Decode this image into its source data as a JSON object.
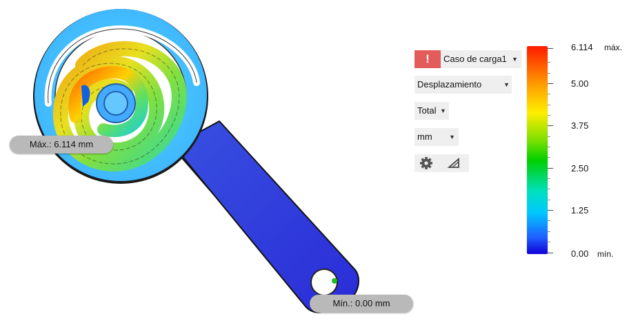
{
  "probes": {
    "max_label": "Máx.: 6.114 mm",
    "min_label": "Mín.: 0.00 mm"
  },
  "panel": {
    "warning_glyph": "!",
    "load_case": "Caso de carga1",
    "result_type": "Desplazamiento",
    "component": "Total",
    "units": "mm",
    "tools": {
      "settings_icon": "gear-icon",
      "deformation_icon": "triangle-scale-icon"
    }
  },
  "legend": {
    "max_value": "6.114",
    "max_tag": "máx.",
    "min_value": "0.00",
    "min_tag": "mín.",
    "ticks": [
      "5.00",
      "3.75",
      "2.50",
      "1.25"
    ],
    "colors": {
      "top": "#ff1a00",
      "bottom": "#1000d8",
      "warning": "#e35b5b"
    }
  }
}
